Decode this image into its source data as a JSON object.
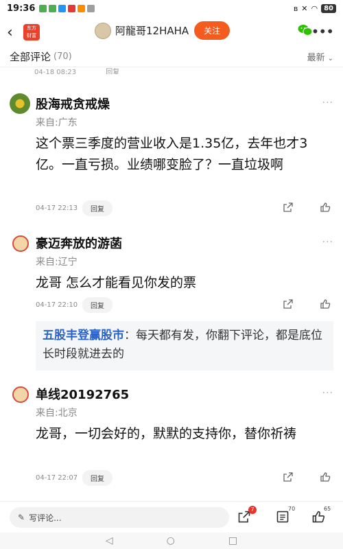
{
  "status_bar": {
    "time": "19:36",
    "battery": "80"
  },
  "nav": {
    "username": "阿龍哥12HAHA",
    "follow_label": "关注",
    "logo_line1": "东方",
    "logo_line2": "财富"
  },
  "comments_header": {
    "title": "全部评论",
    "count": "(70)",
    "sort_label": "最新"
  },
  "partial_row": {
    "timestamp": "04-18 08:23",
    "reply_label": "回复"
  },
  "comments": [
    {
      "author": "股海戒贪戒燥",
      "origin": "来自:广东",
      "text": "这个票三季度的营业收入是1.35亿，去年也才3亿。一直亏损。业绩哪变脸了？一直垃圾啊",
      "timestamp": "04-17 22:13",
      "reply_label": "回复"
    },
    {
      "author": "豪迈奔放的游菡",
      "origin": "来自:辽宁",
      "text": "龙哥  怎么才能看见你发的票",
      "timestamp": "04-17 22:10",
      "reply_label": "回复",
      "reply": {
        "author": "五股丰登赢股市",
        "text": "：每天都有发，你翻下评论，都是底位长时段就进去的"
      }
    },
    {
      "author": "单线20192765",
      "origin": "来自:北京",
      "text": "龙哥，一切会好的，默默的支持你，替你祈祷",
      "timestamp": "04-17 22:07",
      "reply_label": "回复"
    }
  ],
  "bottom_bar": {
    "input_placeholder": "写评论...",
    "share_badge": "7",
    "comment_count": "70",
    "like_count": "65"
  },
  "colors": {
    "accent": "#f35b1f",
    "link": "#2a63c7",
    "badge": "#e8342c"
  },
  "icons": [
    "back-icon",
    "wechat-icon",
    "more-icon",
    "share-icon",
    "like-icon",
    "pencil-icon",
    "comment-list-icon"
  ]
}
